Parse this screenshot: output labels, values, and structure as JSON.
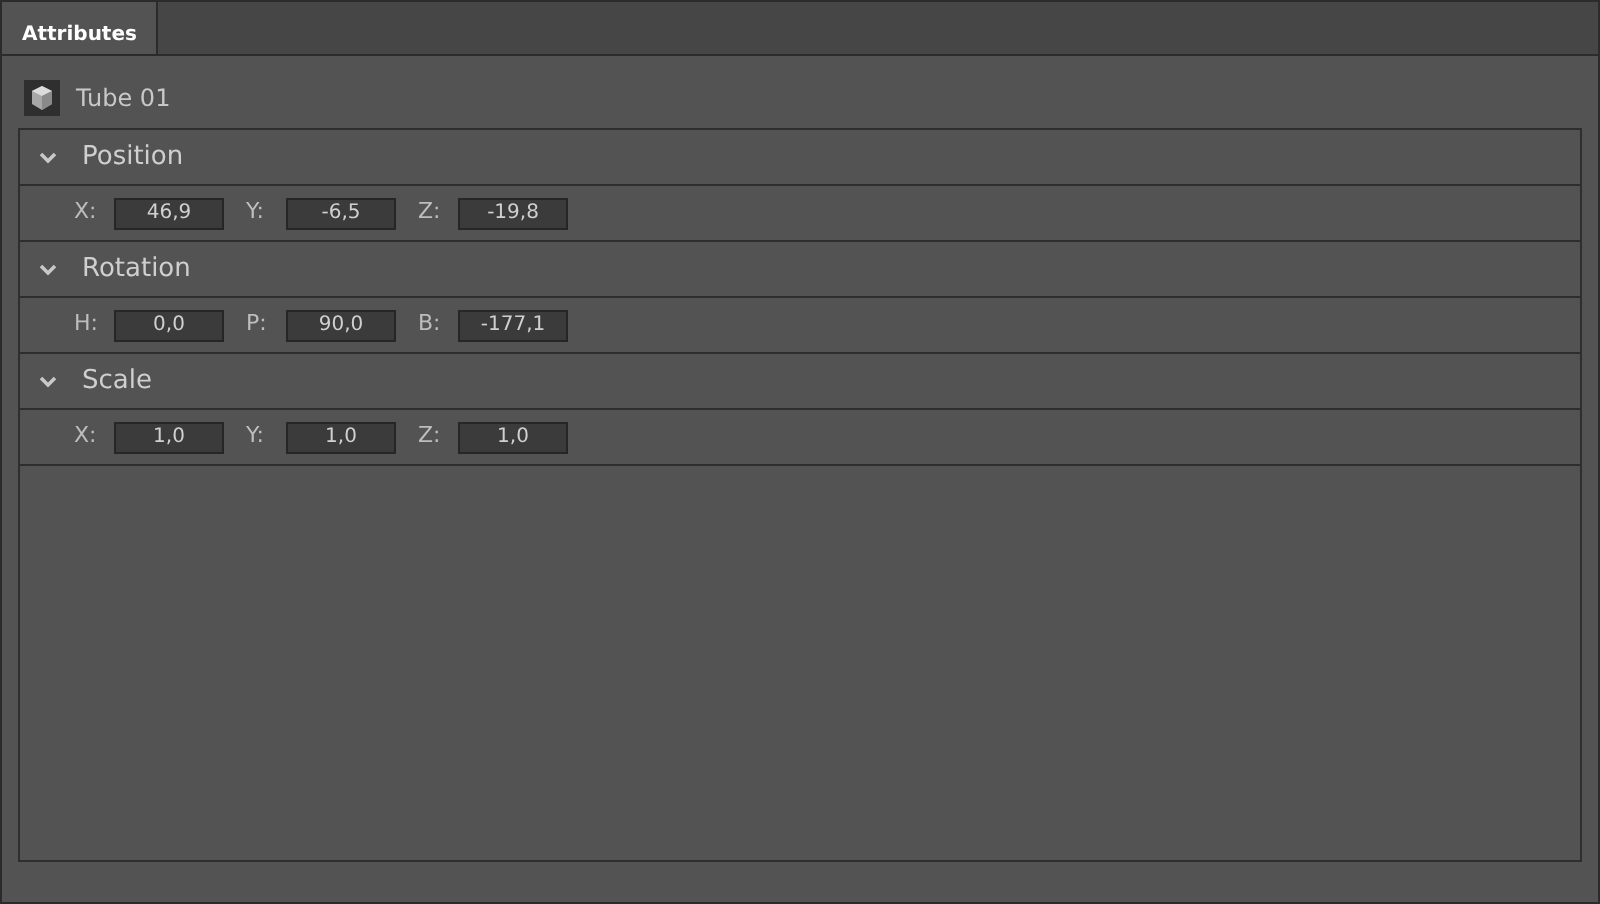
{
  "tabs": [
    {
      "label": "Attributes",
      "selected": true
    }
  ],
  "object": {
    "name": "Tube 01"
  },
  "sections": [
    {
      "title": "Position",
      "expanded": true,
      "fields": [
        {
          "label": "X:",
          "value": "46,9"
        },
        {
          "label": "Y:",
          "value": "-6,5"
        },
        {
          "label": "Z:",
          "value": "-19,8"
        }
      ]
    },
    {
      "title": "Rotation",
      "expanded": true,
      "fields": [
        {
          "label": "H:",
          "value": "0,0"
        },
        {
          "label": "P:",
          "value": "90,0"
        },
        {
          "label": "B:",
          "value": "-177,1"
        }
      ]
    },
    {
      "title": "Scale",
      "expanded": true,
      "fields": [
        {
          "label": "X:",
          "value": "1,0"
        },
        {
          "label": "Y:",
          "value": "1,0"
        },
        {
          "label": "Z:",
          "value": "1,0"
        }
      ]
    }
  ]
}
